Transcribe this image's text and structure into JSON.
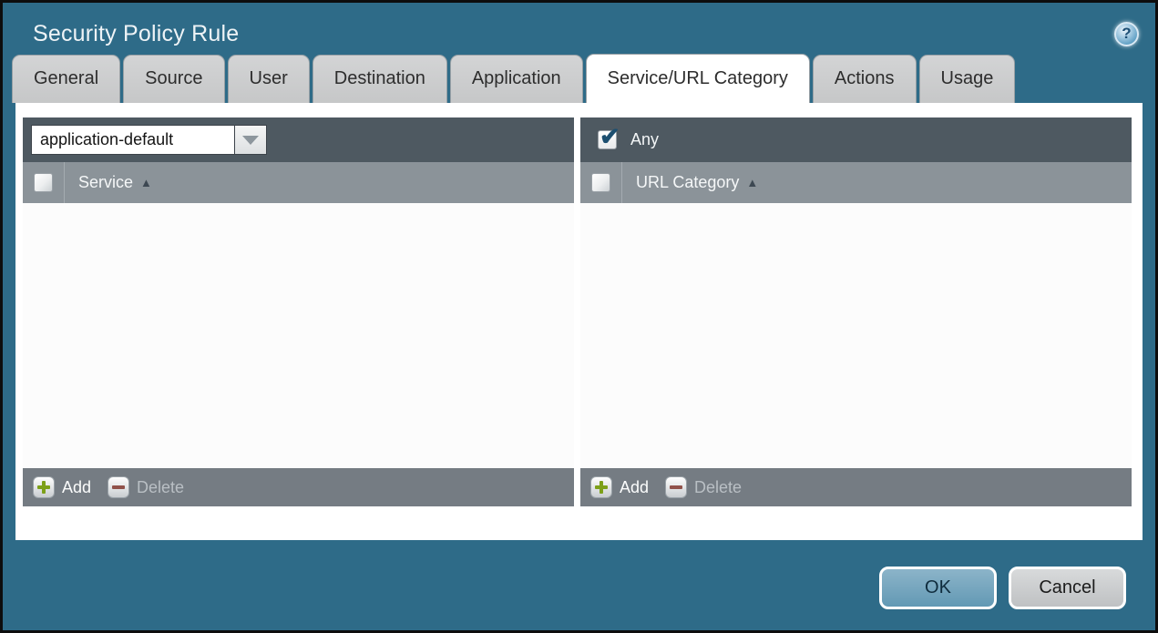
{
  "window": {
    "title": "Security Policy Rule"
  },
  "tabs": [
    {
      "label": "General",
      "active": false
    },
    {
      "label": "Source",
      "active": false
    },
    {
      "label": "User",
      "active": false
    },
    {
      "label": "Destination",
      "active": false
    },
    {
      "label": "Application",
      "active": false
    },
    {
      "label": "Service/URL Category",
      "active": true
    },
    {
      "label": "Actions",
      "active": false
    },
    {
      "label": "Usage",
      "active": false
    }
  ],
  "service_panel": {
    "dropdown": {
      "value": "application-default"
    },
    "header": {
      "label": "Service",
      "sort_icon": "▲",
      "checkbox_checked": false
    },
    "rows": [],
    "footer": {
      "add_label": "Add",
      "delete_label": "Delete",
      "delete_enabled": false
    }
  },
  "url_category_panel": {
    "any_checkbox": {
      "label": "Any",
      "checked": true
    },
    "header": {
      "label": "URL Category",
      "sort_icon": "▲",
      "checkbox_checked": false
    },
    "rows": [],
    "footer": {
      "add_label": "Add",
      "delete_label": "Delete",
      "delete_enabled": false
    }
  },
  "dialog_buttons": {
    "ok": "OK",
    "cancel": "Cancel"
  },
  "icons": {
    "help": "question-mark-circle",
    "add": "green-plus",
    "delete": "red-minus",
    "dropdown": "chevron-down"
  },
  "colors": {
    "dialog_background": "#2e6b88",
    "panel_toolbar": "#4e5961",
    "panel_header": "#8b9399",
    "panel_footer": "#757c83",
    "tab_inactive": "#c9cacb",
    "tab_active": "#ffffff",
    "ok_button": "#6fa3bd",
    "cancel_button": "#c9cbcd",
    "add_plus": "#7da019",
    "delete_minus": "#91524a",
    "checkmark": "#1c4f70"
  }
}
